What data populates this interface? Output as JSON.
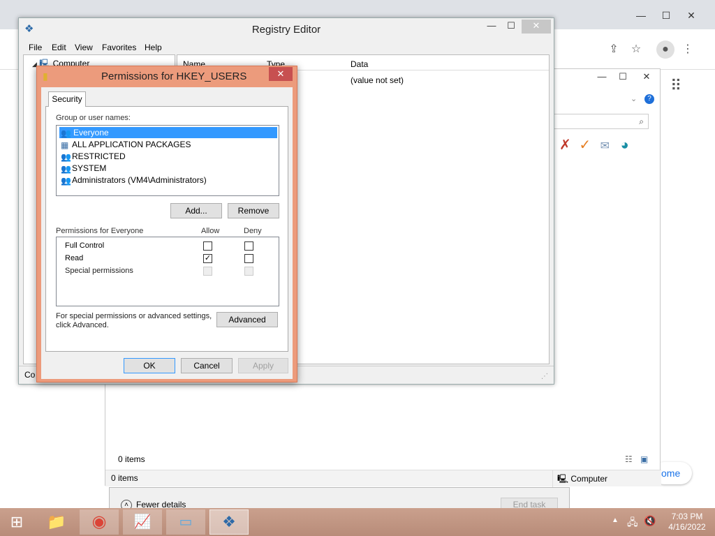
{
  "registry": {
    "title": "Registry Editor",
    "menu": [
      "File",
      "Edit",
      "View",
      "Favorites",
      "Help"
    ],
    "tree_root": "Computer",
    "columns": [
      "Name",
      "Type",
      "Data"
    ],
    "value_data": "(value not set)",
    "status_text": "Co"
  },
  "dialog": {
    "title": "Permissions for HKEY_USERS",
    "tab": "Security",
    "group_label": "Group or user names:",
    "groups": [
      {
        "name": "Everyone",
        "selected": true
      },
      {
        "name": "ALL APPLICATION PACKAGES"
      },
      {
        "name": "RESTRICTED"
      },
      {
        "name": "SYSTEM"
      },
      {
        "name": "Administrators (VM4\\Administrators)"
      }
    ],
    "add_label": "Add...",
    "remove_label": "Remove",
    "permissions_for": "Permissions for Everyone",
    "allow_header": "Allow",
    "deny_header": "Deny",
    "permissions": [
      {
        "name": "Full Control",
        "allow": false,
        "deny": false,
        "disabled": false
      },
      {
        "name": "Read",
        "allow": true,
        "deny": false,
        "disabled": false
      },
      {
        "name": "Special permissions",
        "allow": false,
        "deny": false,
        "disabled": true
      }
    ],
    "special_note": "For special permissions or advanced settings, click Advanced.",
    "advanced_label": "Advanced",
    "ok_label": "OK",
    "cancel_label": "Cancel",
    "apply_label": "Apply"
  },
  "explorer": {
    "items_count": "0 items",
    "status_items": "0 items",
    "status_computer": "Computer"
  },
  "taskmgr": {
    "fewer_details": "Fewer details",
    "end_task": "End task"
  },
  "chrome": {
    "pill_text": "ome"
  },
  "taskbar": {
    "time": "7:03 PM",
    "date": "4/16/2022"
  }
}
